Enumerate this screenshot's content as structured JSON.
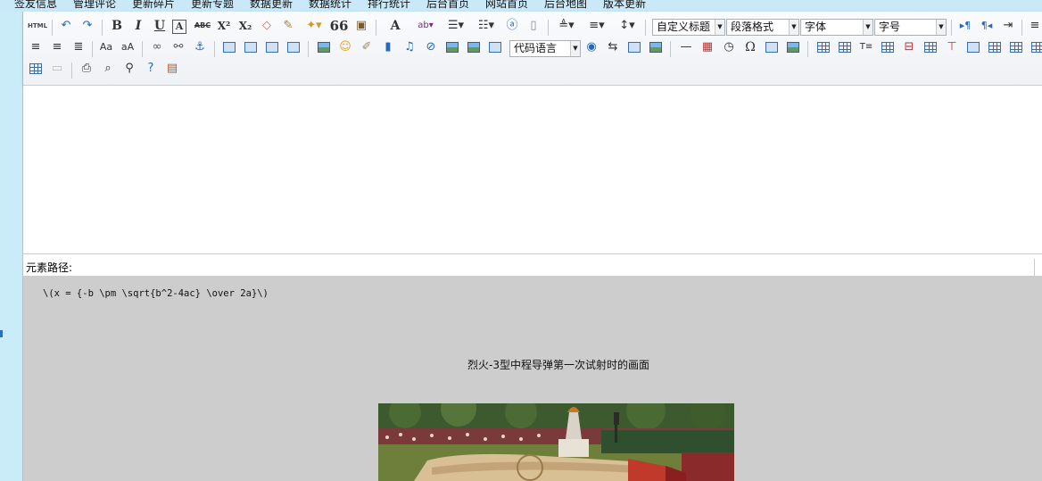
{
  "nav": {
    "items": [
      "签友信息",
      "管理评论",
      "更新碎片",
      "更新专题",
      "数据更新",
      "数据统计",
      "排行统计",
      "后台首页",
      "网站首页",
      "后台地图",
      "版本更新"
    ]
  },
  "toolbar": {
    "html_label": "HTML",
    "bold": "B",
    "italic": "I",
    "underline": "U",
    "strike": "ABC",
    "superscript": "X²",
    "subscript": "X₂",
    "quote": "66",
    "font_color": "A",
    "custom_heading": "自定义标题",
    "paragraph_format": "段落格式",
    "font_family": "字体",
    "font_size": "字号",
    "code_language": "代码语言",
    "omega": "Ω"
  },
  "editor": {
    "path_label": "元素路径:"
  },
  "preview": {
    "formula": "\\(x = {-b \\pm \\sqrt{b^2-4ac} \\over 2a}\\)",
    "caption": "烈火-3型中程导弹第一次试射时的画面"
  },
  "colors": {
    "nav_bg": "#c9e8f8",
    "gutter_bg": "#c9ecf8",
    "preview_bg": "#cdcdcd"
  }
}
